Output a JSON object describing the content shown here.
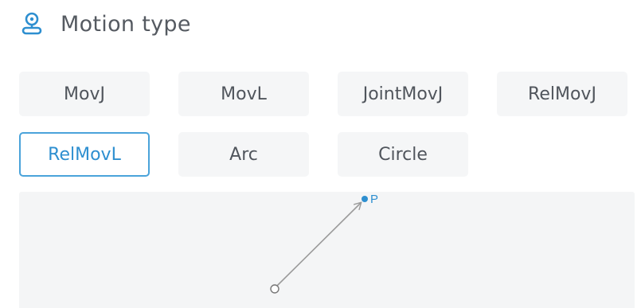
{
  "header": {
    "icon": "location-pin-icon",
    "title": "Motion type"
  },
  "motion_types": [
    {
      "label": "MovJ",
      "selected": false
    },
    {
      "label": "MovL",
      "selected": false
    },
    {
      "label": "JointMovJ",
      "selected": false
    },
    {
      "label": "RelMovJ",
      "selected": false
    },
    {
      "label": "RelMovL",
      "selected": true
    },
    {
      "label": "Arc",
      "selected": false
    },
    {
      "label": "Circle",
      "selected": false
    }
  ],
  "preview": {
    "target_label": "P"
  },
  "colors": {
    "accent": "#2e8fd0",
    "button_bg": "#f5f6f7",
    "preview_bg": "#f4f5f6",
    "path_line": "#9b9b9b"
  }
}
